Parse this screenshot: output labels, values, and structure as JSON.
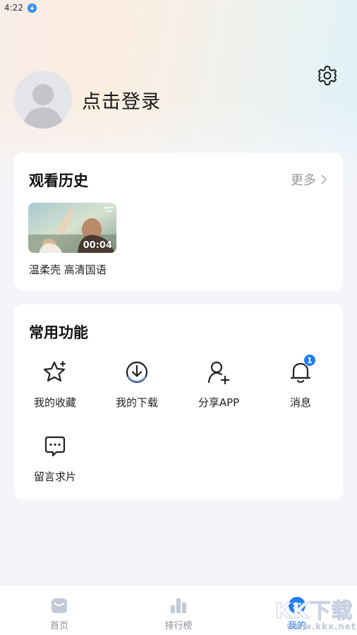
{
  "status_bar": {
    "time": "4:22"
  },
  "header": {
    "login_text": "点击登录"
  },
  "history": {
    "title": "观看历史",
    "more_label": "更多",
    "items": [
      {
        "title": "温柔壳 高清国语",
        "duration": "00:04"
      }
    ]
  },
  "functions": {
    "title": "常用功能",
    "items": [
      {
        "label": "我的收藏",
        "icon": "star-icon"
      },
      {
        "label": "我的下载",
        "icon": "download-icon"
      },
      {
        "label": "分享APP",
        "icon": "add-user-icon"
      },
      {
        "label": "消息",
        "icon": "bell-icon",
        "badge": "1"
      },
      {
        "label": "留言求片",
        "icon": "chat-icon"
      }
    ]
  },
  "tabbar": {
    "tabs": [
      {
        "label": "首页",
        "icon": "home-icon",
        "active": false
      },
      {
        "label": "排行榜",
        "icon": "bar-chart-icon",
        "active": false
      },
      {
        "label": "我的",
        "icon": "profile-icon",
        "active": true
      }
    ]
  },
  "watermark": {
    "main": "KK下载",
    "sub": "www.kkx.net"
  },
  "colors": {
    "accent": "#1e7cf2",
    "background": "#f4f5f8",
    "card": "#ffffff"
  }
}
